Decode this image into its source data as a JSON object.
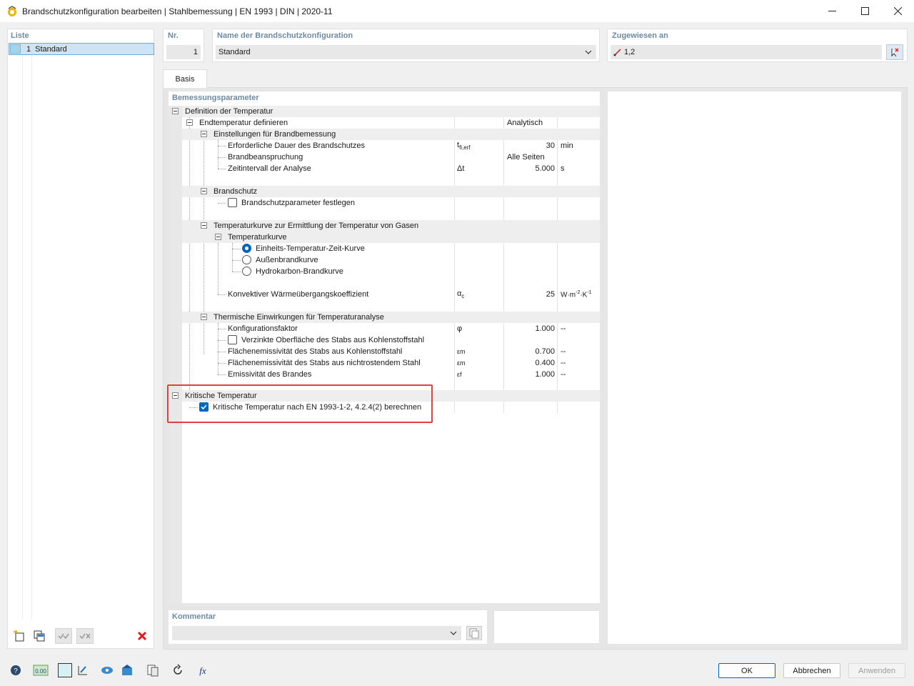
{
  "window": {
    "title": "Brandschutzkonfiguration bearbeiten | Stahlbemessung | EN 1993 | DIN | 2020-11"
  },
  "list": {
    "label": "Liste",
    "items": [
      {
        "number": "1",
        "name": "Standard"
      }
    ]
  },
  "header": {
    "nr_label": "Nr.",
    "nr_value": "1",
    "name_label": "Name der Brandschutzkonfiguration",
    "name_value": "Standard",
    "assigned_label": "Zugewiesen an",
    "assigned_value": "1,2"
  },
  "tabs": [
    {
      "label": "Basis",
      "active": true
    }
  ],
  "params": {
    "label": "Bemessungsparameter",
    "definition_temperature": "Definition der Temperatur",
    "end_temperature": {
      "label": "Endtemperatur definieren",
      "value": "Analytisch"
    },
    "fire_design_settings": "Einstellungen für Brandbemessung",
    "required_duration": {
      "label": "Erforderliche Dauer des Brandschutzes",
      "symbol": "t",
      "symbol_sub": "fi,erf",
      "value": "30",
      "unit": "min"
    },
    "fire_exposure": {
      "label": "Brandbeanspruchung",
      "value": "Alle Seiten"
    },
    "time_interval": {
      "label": "Zeitintervall der Analyse",
      "symbol": "Δt",
      "value": "5.000",
      "unit": "s"
    },
    "fire_protection": "Brandschutz",
    "fire_protection_params": {
      "label": "Brandschutzparameter festlegen",
      "checked": false
    },
    "temp_curve_gases": "Temperaturkurve zur Ermittlung der Temperatur von Gasen",
    "temp_curve": "Temperaturkurve",
    "curve_options": [
      {
        "label": "Einheits-Temperatur-Zeit-Kurve",
        "selected": true
      },
      {
        "label": "Außenbrandkurve",
        "selected": false
      },
      {
        "label": "Hydrokarbon-Brandkurve",
        "selected": false
      }
    ],
    "convective_coeff": {
      "label": "Konvektiver Wärmeübergangskoeffizient",
      "symbol": "α",
      "symbol_sub": "c",
      "value": "25",
      "unit": "W·m",
      "unit_sup1": "-2",
      "unit_mid": "·K",
      "unit_sup2": "-1"
    },
    "thermal_actions": "Thermische Einwirkungen für Temperaturanalyse",
    "config_factor": {
      "label": "Konfigurationsfaktor",
      "symbol": "φ",
      "value": "1.000",
      "unit": "--"
    },
    "galvanized_surface": {
      "label": "Verzinkte Oberfläche des Stabs aus Kohlenstoffstahl",
      "checked": false
    },
    "emissivity_carbon": {
      "label": "Flächenemissivität des Stabs aus Kohlenstoffstahl",
      "symbol": "εm",
      "value": "0.700",
      "unit": "--"
    },
    "emissivity_stainless": {
      "label": "Flächenemissivität des Stabs aus nichtrostendem Stahl",
      "symbol": "εm",
      "value": "0.400",
      "unit": "--"
    },
    "emissivity_fire": {
      "label": "Emissivität des Brandes",
      "symbol": "εf",
      "value": "1.000",
      "unit": "--"
    },
    "critical_temperature": "Kritische Temperatur",
    "critical_calc": {
      "label": "Kritische Temperatur nach EN 1993-1-2, 4.2.4(2) berechnen",
      "checked": true
    }
  },
  "comment": {
    "label": "Kommentar",
    "value": ""
  },
  "buttons": {
    "ok": "OK",
    "cancel": "Abbrechen",
    "apply": "Anwenden"
  },
  "colors": {
    "accent": "#0067c0",
    "label": "#6e8aa3",
    "highlight": "#e04040",
    "delete": "#e02020"
  }
}
